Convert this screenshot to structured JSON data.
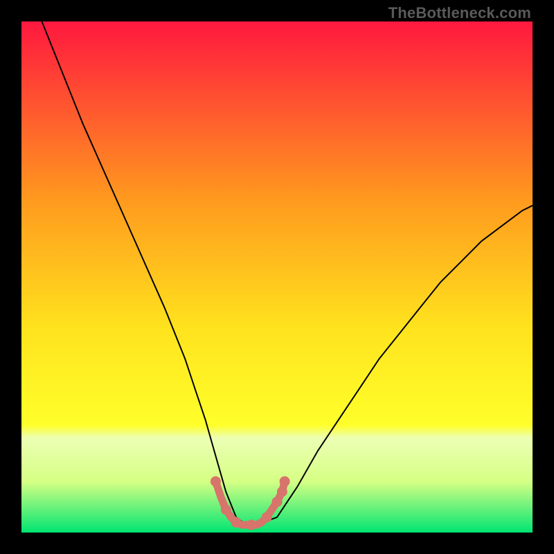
{
  "watermark": "TheBottleneck.com",
  "colors": {
    "frame": "#000000",
    "gradient_top": "#ff183f",
    "gradient_mid1": "#ff9a1e",
    "gradient_mid2": "#ffe31e",
    "gradient_mid3": "#ffff2a",
    "gradient_mid4": "#ecffb4",
    "gradient_mid5": "#d6ff84",
    "gradient_bottom": "#00e572",
    "curve": "#000000",
    "marker_fill": "#d7746b",
    "marker_stroke": "#d7746b"
  },
  "chart_data": {
    "type": "line",
    "title": "",
    "xlabel": "",
    "ylabel": "",
    "xlim": [
      0,
      100
    ],
    "ylim": [
      0,
      100
    ],
    "series": [
      {
        "name": "bottleneck-curve",
        "x": [
          4,
          8,
          12,
          16,
          20,
          24,
          28,
          32,
          34,
          36,
          38,
          40,
          42,
          44,
          46,
          50,
          54,
          58,
          62,
          66,
          70,
          74,
          78,
          82,
          86,
          90,
          94,
          98,
          100
        ],
        "y": [
          100,
          90,
          80,
          71,
          62,
          53,
          44,
          34,
          28,
          22,
          15,
          8,
          3,
          1.5,
          1.5,
          3,
          9,
          16,
          22,
          28,
          34,
          39,
          44,
          49,
          53,
          57,
          60,
          63,
          64
        ]
      }
    ],
    "marker_segment": {
      "x": [
        38,
        39,
        40,
        41,
        42,
        43,
        44,
        45,
        46,
        47,
        48,
        49,
        50,
        51,
        51.5
      ],
      "y": [
        10,
        7,
        4.5,
        3,
        2,
        1.5,
        1.5,
        1.5,
        1.5,
        2,
        3,
        4.5,
        6,
        8,
        10
      ]
    }
  }
}
